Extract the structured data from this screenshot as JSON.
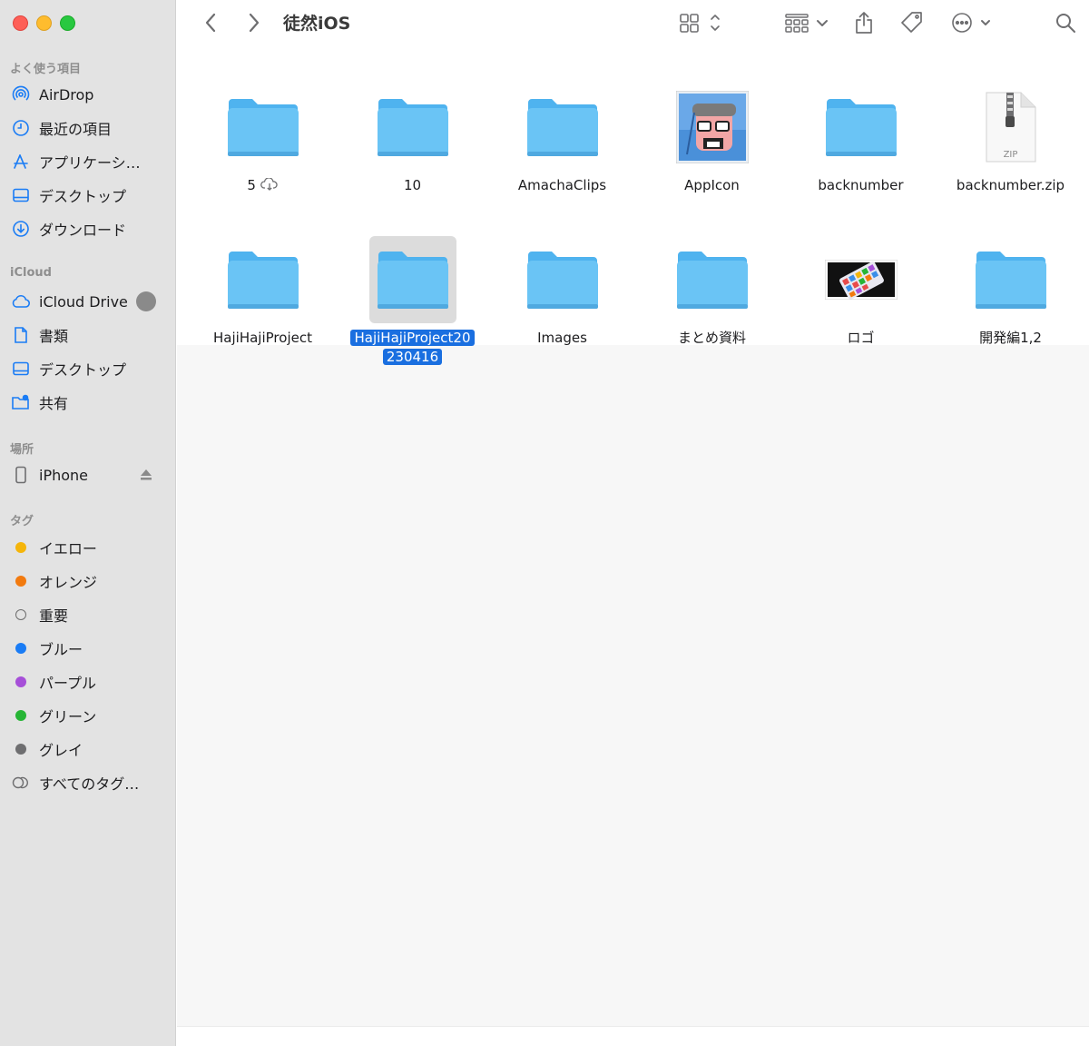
{
  "window": {
    "title": "徒然iOS"
  },
  "sidebar": {
    "favorites_title": "よく使う項目",
    "favorites": [
      {
        "label": "AirDrop",
        "icon": "airdrop-icon"
      },
      {
        "label": "最近の項目",
        "icon": "clock-icon"
      },
      {
        "label": "アプリケーシ…",
        "icon": "applications-icon"
      },
      {
        "label": "デスクトップ",
        "icon": "desktop-icon"
      },
      {
        "label": "ダウンロード",
        "icon": "download-icon"
      }
    ],
    "icloud_title": "iCloud",
    "icloud": [
      {
        "label": "iCloud Drive",
        "icon": "icloud-icon"
      },
      {
        "label": "書類",
        "icon": "document-icon"
      },
      {
        "label": "デスクトップ",
        "icon": "desktop-icon"
      },
      {
        "label": "共有",
        "icon": "shared-folder-icon"
      }
    ],
    "locations_title": "場所",
    "locations": [
      {
        "label": "iPhone",
        "icon": "iphone-icon"
      }
    ],
    "tags_title": "タグ",
    "tags": [
      {
        "label": "イエロー",
        "color": "#f5b50a"
      },
      {
        "label": "オレンジ",
        "color": "#f27a0f"
      },
      {
        "label": "重要",
        "color": ""
      },
      {
        "label": "ブルー",
        "color": "#1a7cf5"
      },
      {
        "label": "パープル",
        "color": "#a64fd8"
      },
      {
        "label": "グリーン",
        "color": "#26b535"
      },
      {
        "label": "グレイ",
        "color": "#6e6e70"
      },
      {
        "label": "すべてのタグ…",
        "color": "all"
      }
    ]
  },
  "files": [
    {
      "name": "5",
      "type": "folder",
      "cloud": true
    },
    {
      "name": "10",
      "type": "folder"
    },
    {
      "name": "AmachaClips",
      "type": "folder"
    },
    {
      "name": "AppIcon",
      "type": "image-appicon"
    },
    {
      "name": "backnumber",
      "type": "folder"
    },
    {
      "name": "backnumber.zip",
      "type": "zip",
      "badge": "ZIP"
    },
    {
      "name": "HajiHajiProject",
      "type": "folder"
    },
    {
      "name_line1": "HajiHajiProject20",
      "name_line2": "230416",
      "type": "folder",
      "selected": true
    },
    {
      "name": "Images",
      "type": "folder"
    },
    {
      "name": "まとめ資料",
      "type": "folder"
    },
    {
      "name": "ロゴ",
      "type": "image-logo"
    },
    {
      "name": "開発編1,2",
      "type": "folder"
    }
  ],
  "colors": {
    "folder_top": "#4fb3ef",
    "folder_body": "#6ac4f5",
    "selection": "#1a6fe0"
  }
}
